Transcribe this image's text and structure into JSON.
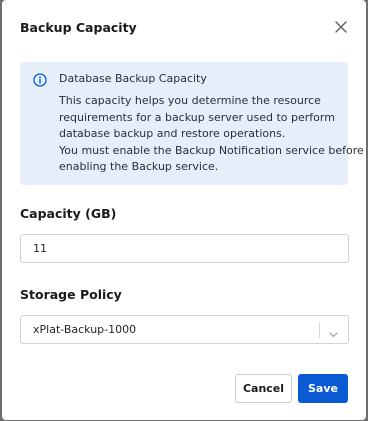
{
  "dialog": {
    "title": "Backup Capacity",
    "close_icon": "close-icon"
  },
  "info": {
    "icon": "info-icon",
    "title": "Database Backup Capacity",
    "lines": [
      "This capacity helps you determine the resource",
      "requirements for a backup server used to perform",
      "database backup and restore operations.",
      "You must enable the Backup Notification service before",
      "enabling the Backup service."
    ]
  },
  "capacity": {
    "label": "Capacity (GB)",
    "value": "11"
  },
  "storage_policy": {
    "label": "Storage Policy",
    "selected": "xPlat-Backup-1000",
    "chevron_icon": "chevron-down-icon"
  },
  "buttons": {
    "cancel_label": "Cancel",
    "save_label": "Save"
  },
  "colors": {
    "accent": "#0a5bd3",
    "info_background": "#e5eef9",
    "overlay": "#6f6f6f"
  }
}
